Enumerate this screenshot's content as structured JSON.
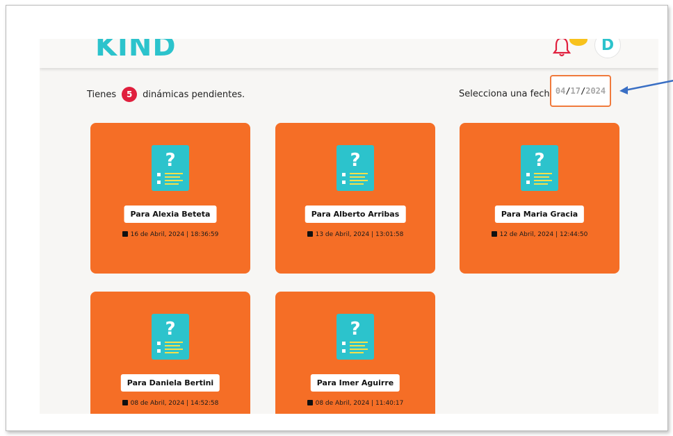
{
  "app": {
    "logo": "KIND",
    "avatar_initial": "D"
  },
  "header": {
    "pending_prefix": "Tienes",
    "pending_count": "5",
    "pending_suffix": "dinámicas pendientes.",
    "date_label": "Selecciona una fecha:",
    "date_value": {
      "month": "04",
      "day": "17",
      "year": "2024",
      "sep": "/"
    }
  },
  "cards": [
    {
      "name": "Para Alexia Beteta",
      "date": "16 de Abril, 2024 | 18:36:59"
    },
    {
      "name": "Para Alberto Arribas",
      "date": "13 de Abril, 2024 | 13:01:58"
    },
    {
      "name": "Para Maria Gracia",
      "date": "12 de Abril, 2024 | 12:44:50"
    },
    {
      "name": "Para Daniela Bertini",
      "date": "08 de Abril, 2024 | 14:52:58"
    },
    {
      "name": "Para Imer Aguirre",
      "date": "08 de Abril, 2024 | 11:40:17"
    }
  ],
  "colors": {
    "brand_teal": "#2cc3cc",
    "card_orange": "#f56e26",
    "badge_red": "#e01f3d",
    "arrow_blue": "#3a6fc4"
  },
  "icons": {
    "notification": "bell-icon",
    "card": "question-document-icon",
    "date": "calendar-icon",
    "annotation": "arrow-icon"
  }
}
